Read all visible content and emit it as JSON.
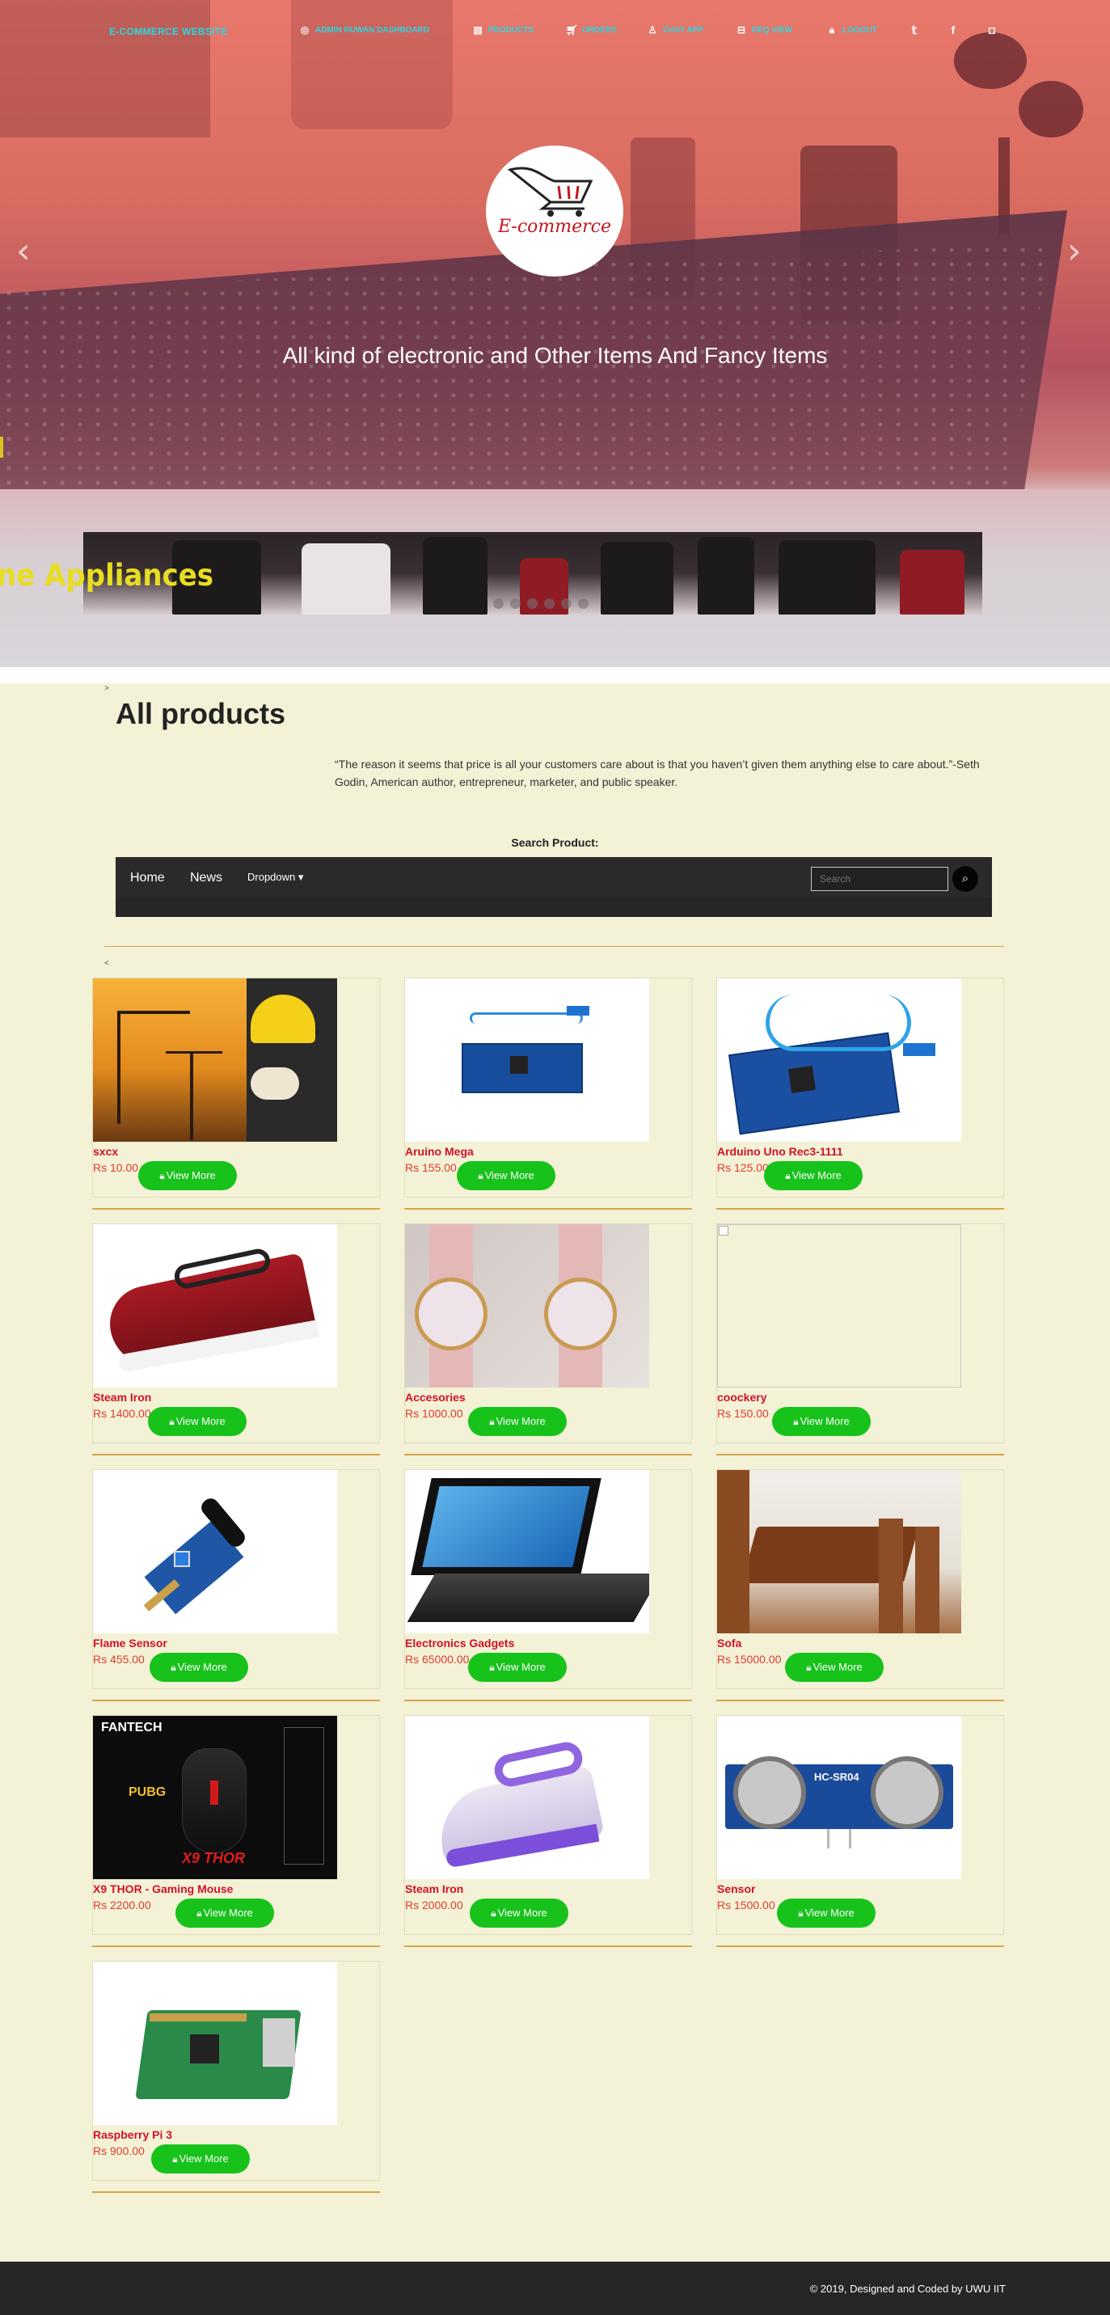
{
  "nav": {
    "brand": "E-COMMERCE WEBSITE",
    "items": [
      {
        "label": "ADMIN RUWAN DASHBOARD",
        "icon": "user-circle-icon"
      },
      {
        "label": "PRODUCTS",
        "icon": "receipt-icon"
      },
      {
        "label": "ORDERS",
        "icon": "cart-icon"
      },
      {
        "label": "CHAT APP",
        "icon": "person-icon"
      },
      {
        "label": "REQ VIEW",
        "icon": "basket-icon"
      },
      {
        "label": "LOGOUT",
        "icon": "lock-icon"
      }
    ],
    "social": [
      "twitter-icon",
      "facebook-icon",
      "instagram-icon"
    ]
  },
  "hero": {
    "logo_text": "E-commerce",
    "tagline": "All kind of electronic and Other Items And Fancy Items",
    "slide_caption": "ne Appliances",
    "dots_count": 6
  },
  "page": {
    "breadcrumb_mark": ">",
    "title": "All products",
    "quote": "“The reason it seems that price is all your customers care about is that you haven’t given them anything else to care about.”-Seth Godin, American author, entrepreneur, marketer, and public speaker.",
    "search_label": "Search Product:",
    "small_mark": "<"
  },
  "search_nav": {
    "home": "Home",
    "news": "News",
    "dropdown": "Dropdown",
    "search_placeholder": "Search"
  },
  "button_label": "View More",
  "products": [
    {
      "name": "sxcx",
      "price": "Rs 10.00",
      "art": "construction"
    },
    {
      "name": "Aruino Mega",
      "price": "Rs 155.00",
      "art": "arduino-mega"
    },
    {
      "name": "Arduino Uno Rec3-1111",
      "price": "Rs 125.00",
      "art": "arduino-uno"
    },
    {
      "name": "Steam Iron",
      "price": "Rs 1400.00",
      "art": "iron-red"
    },
    {
      "name": "Accesories",
      "price": "Rs 1000.00",
      "art": "watches"
    },
    {
      "name": "coockery",
      "price": "Rs 150.00",
      "art": "broken"
    },
    {
      "name": "Flame Sensor",
      "price": "Rs 455.00",
      "art": "flame-sensor"
    },
    {
      "name": "Electronics Gadgets",
      "price": "Rs 65000.00",
      "art": "laptop"
    },
    {
      "name": "Sofa",
      "price": "Rs 15000.00",
      "art": "dining"
    },
    {
      "name": "X9 THOR - Gaming Mouse",
      "price": "Rs 2200.00",
      "art": "mouse"
    },
    {
      "name": "Steam Iron",
      "price": "Rs 2000.00",
      "art": "iron-purple"
    },
    {
      "name": "Sensor",
      "price": "Rs 1500.00",
      "art": "ultrasonic"
    },
    {
      "name": "Raspberry Pi 3",
      "price": "Rs 900.00",
      "art": "raspberry"
    }
  ],
  "mouse_image_text": {
    "brand": "FANTECH",
    "model": "X9 THOR",
    "badge": "PUBG"
  },
  "sensor_image_text": "HC-SR04",
  "footer": {
    "text": "© 2019, Designed and Coded by UWU IIT"
  }
}
